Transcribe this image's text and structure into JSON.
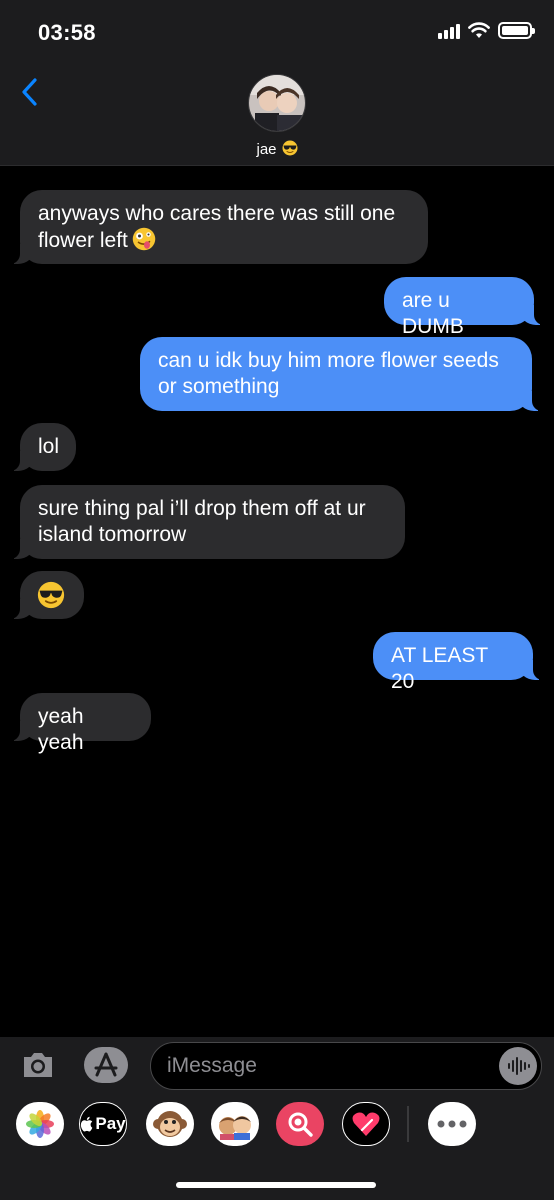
{
  "status_bar": {
    "time": "03:58"
  },
  "header": {
    "contact_name": "jae",
    "contact_emoji": "sunglasses-emoji"
  },
  "messages": [
    {
      "direction": "incoming",
      "text": "anyways who cares there was still one flower left",
      "emoji": "zany-face-emoji"
    },
    {
      "direction": "outgoing",
      "text": "are u DUMB"
    },
    {
      "direction": "outgoing",
      "text": "can u idk buy him more flower seeds or something"
    },
    {
      "direction": "incoming",
      "text": "lol"
    },
    {
      "direction": "incoming",
      "text": "sure thing pal i’ll drop them off at ur island tomorrow"
    },
    {
      "direction": "incoming",
      "text": "",
      "emoji": "sunglasses-emoji"
    },
    {
      "direction": "outgoing",
      "text": "AT LEAST 20"
    },
    {
      "direction": "incoming",
      "text": "yeah yeah"
    }
  ],
  "composer": {
    "placeholder": "iMessage"
  },
  "app_drawer": {
    "apps": [
      "photos-icon",
      "apple-pay-icon",
      "monkey-animoji-icon",
      "memoji-icon",
      "image-search-icon",
      "digital-touch-icon",
      "more-icon"
    ],
    "pay_label": "Pay"
  },
  "colors": {
    "incoming_bubble": "#2c2c2e",
    "outgoing_bubble": "#4c8ff7",
    "accent": "#0a84ff",
    "background": "#000000"
  }
}
